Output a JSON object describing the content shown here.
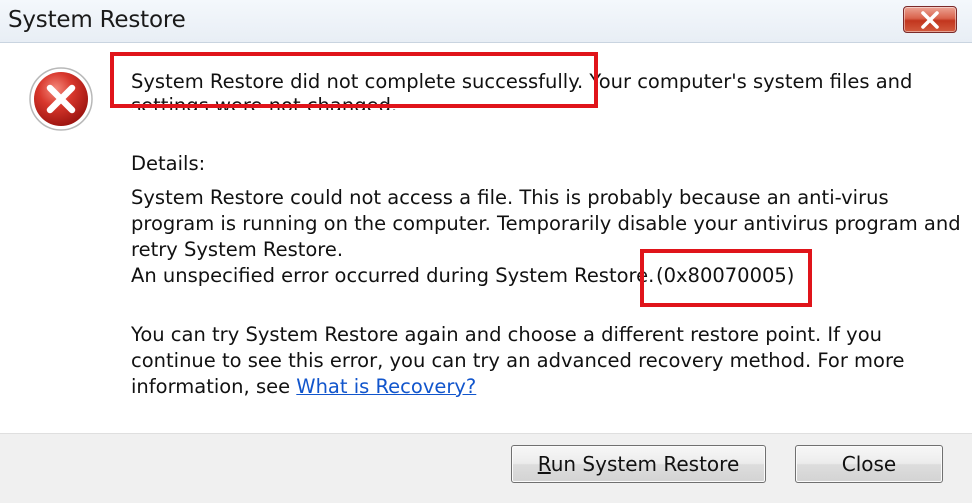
{
  "window": {
    "title": "System Restore",
    "close_glyph": "close-icon"
  },
  "icon": {
    "name": "error-icon",
    "color": "#d32f2f"
  },
  "message": {
    "headline": "System Restore did not complete successfully. Your computer's system files and",
    "headline_cont": "settings were not changed.",
    "details_label": "Details:",
    "details": [
      "System Restore could not access a file. This is probably because an anti-virus",
      "program is running on the computer. Temporarily disable your antivirus program and",
      "retry System Restore.",
      "An unspecified error occurred during System Restore."
    ],
    "error_code": "(0x80070005)",
    "hint": [
      "You can try System Restore again and choose a different restore point.  If you",
      "continue to see this error, you can try an advanced recovery method. For more",
      "information, see "
    ],
    "link": "What is Recovery?"
  },
  "buttons": {
    "run": {
      "mnemonic": "R",
      "rest": "un System Restore"
    },
    "close": "Close"
  },
  "colors": {
    "annotation": "#e0141a",
    "link": "#1155cc"
  }
}
